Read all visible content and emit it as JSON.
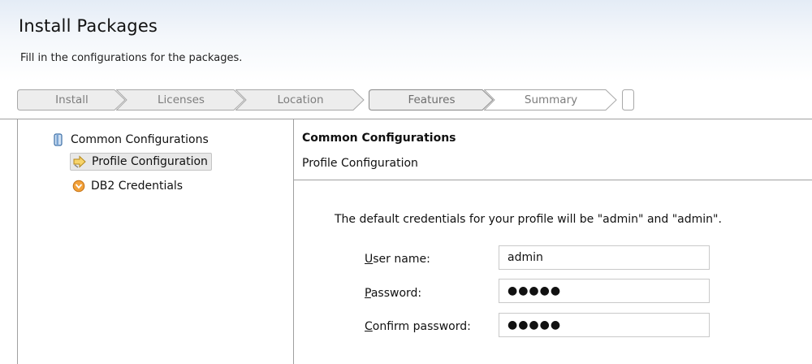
{
  "header": {
    "title": "Install Packages",
    "subtitle": "Fill in the configurations for the packages."
  },
  "steps": [
    {
      "label": "Install",
      "state": "done"
    },
    {
      "label": "Licenses",
      "state": "done"
    },
    {
      "label": "Location",
      "state": "done"
    },
    {
      "label": "Features",
      "state": "current"
    },
    {
      "label": "Summary",
      "state": "pending"
    }
  ],
  "tree": {
    "root": {
      "label": "Common Configurations",
      "icon": "book-icon"
    },
    "children": [
      {
        "label": "Profile Configuration",
        "icon": "arrow-right-icon",
        "selected": true
      },
      {
        "label": "DB2 Credentials",
        "icon": "warning-circle-icon",
        "selected": false
      }
    ]
  },
  "panel": {
    "title": "Common Configurations",
    "subtitle": "Profile Configuration",
    "info": "The default credentials for your profile will be \"admin\" and \"admin\".",
    "fields": {
      "username": {
        "mnemonic": "U",
        "rest": "ser name:",
        "value": "admin"
      },
      "password": {
        "mnemonic": "P",
        "rest": "assword:",
        "value": "●●●●●"
      },
      "confirm": {
        "mnemonic": "C",
        "rest": "onfirm password:",
        "value": "●●●●●"
      }
    }
  },
  "colors": {
    "header_gradient_top": "#e4ecf6",
    "step_fill": "#ededed",
    "step_border": "#a8a8a8",
    "divider": "#a0a0a0"
  }
}
